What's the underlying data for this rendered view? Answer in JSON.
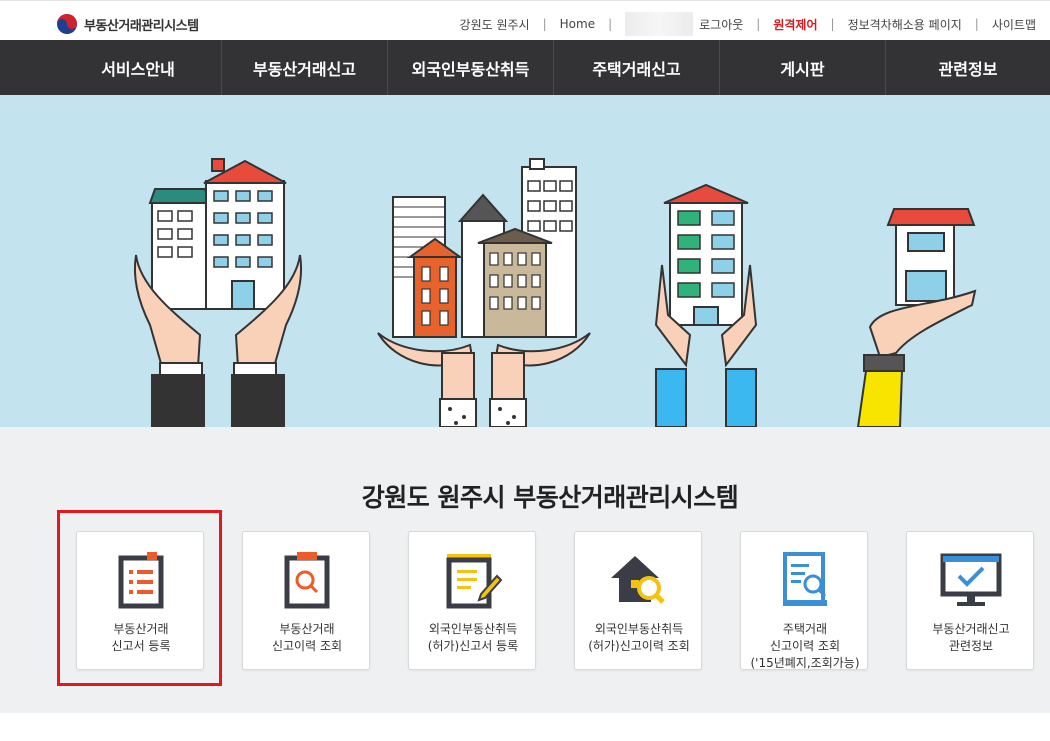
{
  "header": {
    "logo_text": "부동산거래관리시스템",
    "links": {
      "region": "강원도 원주시",
      "home": "Home",
      "logout": "로그아웃",
      "remote": "원격제어",
      "accessibility": "정보격차해소용 페이지",
      "sitemap": "사이트맵"
    }
  },
  "nav": {
    "items": [
      "서비스안내",
      "부동산거래신고",
      "외국인부동산취득",
      "주택거래신고",
      "게시판",
      "관련정보"
    ]
  },
  "main": {
    "title": "강원도 원주시 부동산거래관리시스템",
    "cards": [
      {
        "label": "부동산거래\n신고서 등록",
        "icon": "report-register-icon"
      },
      {
        "label": "부동산거래\n신고이력 조회",
        "icon": "report-search-icon"
      },
      {
        "label": "외국인부동산취득\n(허가)신고서 등록",
        "icon": "document-edit-icon"
      },
      {
        "label": "외국인부동산취득\n(허가)신고이력 조회",
        "icon": "house-search-icon"
      },
      {
        "label": "주택거래\n신고이력 조회\n('15년폐지,조회가능)",
        "icon": "document-search-icon"
      },
      {
        "label": "부동산거래신고\n관련정보",
        "icon": "monitor-check-icon"
      }
    ]
  },
  "colors": {
    "nav_bg": "#333335",
    "hero_bg": "#c3e3ee",
    "accent_red": "#e3181f",
    "icon_orange": "#f05a28",
    "icon_dark": "#3a3d45",
    "icon_yellow": "#f5c211",
    "icon_blue": "#3a8fd6"
  }
}
